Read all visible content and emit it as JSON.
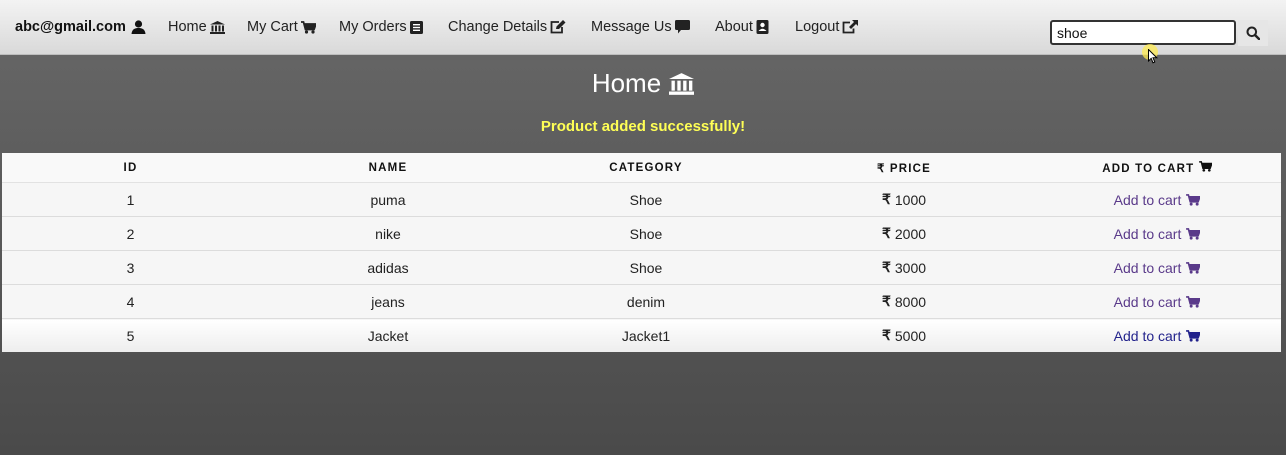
{
  "nav": {
    "user_email": "abc@gmail.com",
    "items": [
      {
        "label": "Home",
        "icon": "bank-icon"
      },
      {
        "label": "My Cart",
        "icon": "cart-icon"
      },
      {
        "label": "My Orders",
        "icon": "list-icon"
      },
      {
        "label": "Change Details",
        "icon": "edit-icon"
      },
      {
        "label": "Message Us",
        "icon": "comment-icon"
      },
      {
        "label": "About",
        "icon": "address-book-icon"
      },
      {
        "label": "Logout",
        "icon": "external-link-icon"
      }
    ],
    "search_value": "shoe"
  },
  "page": {
    "title": "Home",
    "flash_message": "Product added successfully!"
  },
  "table": {
    "headers": {
      "id": "ID",
      "name": "NAME",
      "category": "CATEGORY",
      "price": "PRICE",
      "add_to_cart": "ADD TO CART"
    },
    "currency_symbol": "₹",
    "rows": [
      {
        "id": "1",
        "name": "puma",
        "category": "Shoe",
        "price": "1000",
        "action": "Add to cart"
      },
      {
        "id": "2",
        "name": "nike",
        "category": "Shoe",
        "price": "2000",
        "action": "Add to cart"
      },
      {
        "id": "3",
        "name": "adidas",
        "category": "Shoe",
        "price": "3000",
        "action": "Add to cart"
      },
      {
        "id": "4",
        "name": "jeans",
        "category": "denim",
        "price": "8000",
        "action": "Add to cart"
      },
      {
        "id": "5",
        "name": "Jacket",
        "category": "Jacket1",
        "price": "5000",
        "action": "Add to cart"
      }
    ]
  },
  "colors": {
    "flash": "#ffff55",
    "link": "#5a3a8a",
    "link_active": "#23238c"
  }
}
